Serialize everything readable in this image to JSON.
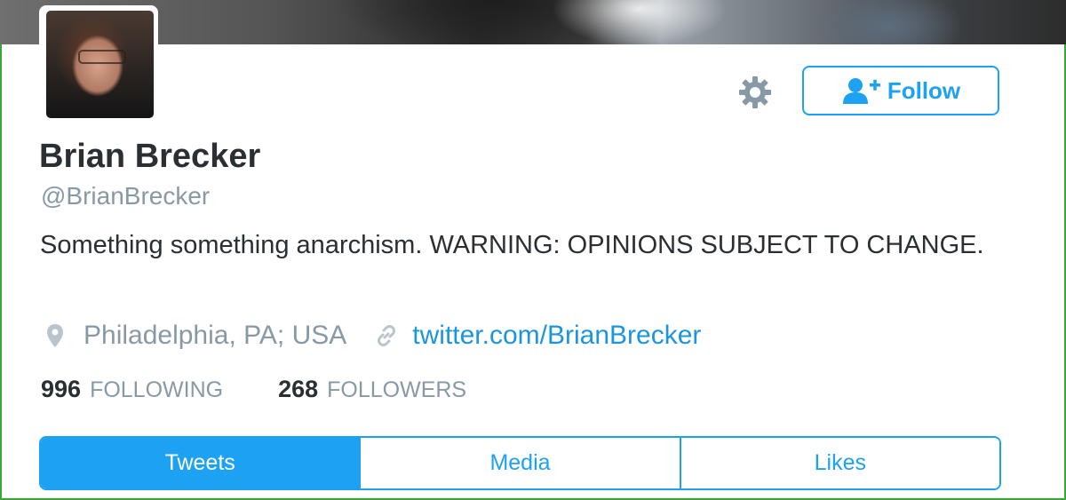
{
  "profile": {
    "display_name": "Brian Brecker",
    "screen_name": "@BrianBrecker",
    "bio": "Something something anarchism. WARNING: OPINIONS SUBJECT TO CHANGE.",
    "location": "Philadelphia, PA; USA",
    "url": "twitter.com/BrianBrecker"
  },
  "actions": {
    "settings_icon": "gear-icon",
    "follow_label": "Follow",
    "follow_icon": "add-user-icon"
  },
  "stats": {
    "following_count": "996",
    "following_label": "FOLLOWING",
    "followers_count": "268",
    "followers_label": "FOLLOWERS"
  },
  "tabs": [
    {
      "label": "Tweets",
      "active": true
    },
    {
      "label": "Media",
      "active": false
    },
    {
      "label": "Likes",
      "active": false
    }
  ],
  "colors": {
    "accent": "#1da1f2",
    "text_primary": "#292f33",
    "text_secondary": "#8899a6",
    "link": "#1b95e0"
  }
}
